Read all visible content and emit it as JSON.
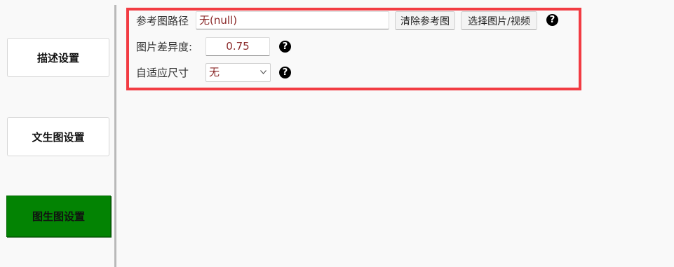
{
  "nav": {
    "items": [
      {
        "label": "描述设置",
        "active": false
      },
      {
        "label": "文生图设置",
        "active": false
      },
      {
        "label": "图生图设置",
        "active": true
      }
    ]
  },
  "colors": {
    "active_nav": "#038303",
    "highlight_frame": "#f23c43",
    "value_text": "#8b2a2a"
  },
  "settings": {
    "ref_path": {
      "label": "参考图路径",
      "value": "无(null)",
      "clear_button": "清除参考图",
      "choose_button": "选择图片/视频",
      "help_icon": "question-icon"
    },
    "diff": {
      "label": "图片差异度:",
      "value": "0.75",
      "help_icon": "question-icon"
    },
    "adaptive": {
      "label": "自适应尺寸",
      "selected": "无",
      "help_icon": "question-icon"
    }
  }
}
